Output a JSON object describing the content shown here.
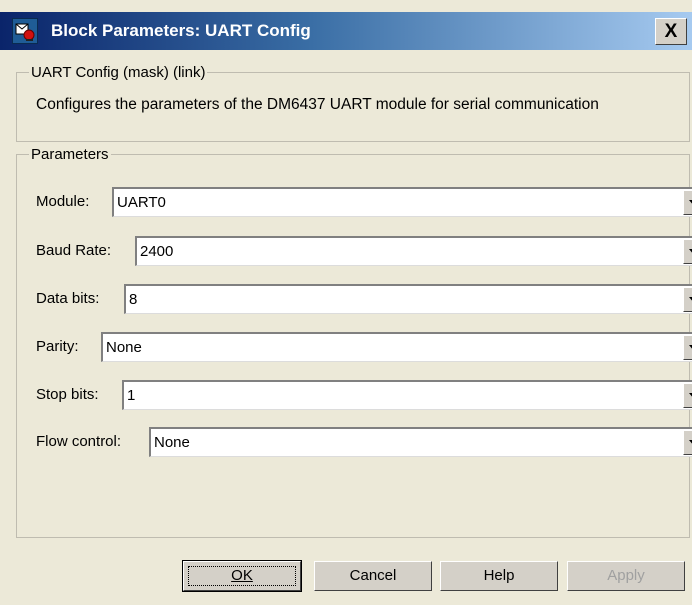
{
  "window": {
    "title": "Block Parameters: UART Config",
    "close_label": "X"
  },
  "mask_group": {
    "legend": "UART Config (mask) (link)",
    "description": "Configures the parameters of the DM6437 UART module for serial communication"
  },
  "params_group": {
    "legend": "Parameters"
  },
  "params": {
    "module": {
      "label": "Module:",
      "value": "UART0"
    },
    "baud_rate": {
      "label": "Baud Rate:",
      "value": "2400"
    },
    "data_bits": {
      "label": "Data bits:",
      "value": "8"
    },
    "parity": {
      "label": "Parity:",
      "value": "None"
    },
    "stop_bits": {
      "label": "Stop bits:",
      "value": "1"
    },
    "flow_control": {
      "label": "Flow control:",
      "value": "None"
    }
  },
  "buttons": {
    "ok": "OK",
    "cancel": "Cancel",
    "help": "Help",
    "apply": "Apply"
  }
}
